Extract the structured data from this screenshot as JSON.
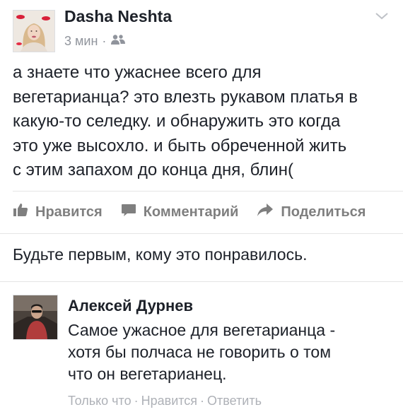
{
  "post": {
    "author": "Dasha Neshta",
    "time": "3 мин",
    "meta_separator": "·",
    "privacy_icon": "friends-icon",
    "text_lines": [
      "а знаете что ужаснее всего для",
      "вегетарианца? это влезть рукавом платья в",
      "какую-то селедку. и обнаружить это когда",
      "это уже высохло. и быть обреченной жить",
      "с этим запахом до конца дня, блин("
    ]
  },
  "actions": {
    "like": "Нравится",
    "comment": "Комментарий",
    "share": "Поделиться"
  },
  "likes_text": "Будьте первым, кому это понравилось.",
  "comment": {
    "author": "Алексей Дурнев",
    "text_lines": [
      "Самое ужасное для вегетарианца -",
      "хотя бы полчаса не говорить о том",
      "что он вегетарианец."
    ],
    "time": "Только что",
    "separator": "·",
    "like": "Нравится",
    "reply": "Ответить"
  },
  "colors": {
    "text": "#1d2129",
    "meta": "#90949c",
    "action": "#7f7f7f",
    "divider": "#e5e5e5"
  }
}
